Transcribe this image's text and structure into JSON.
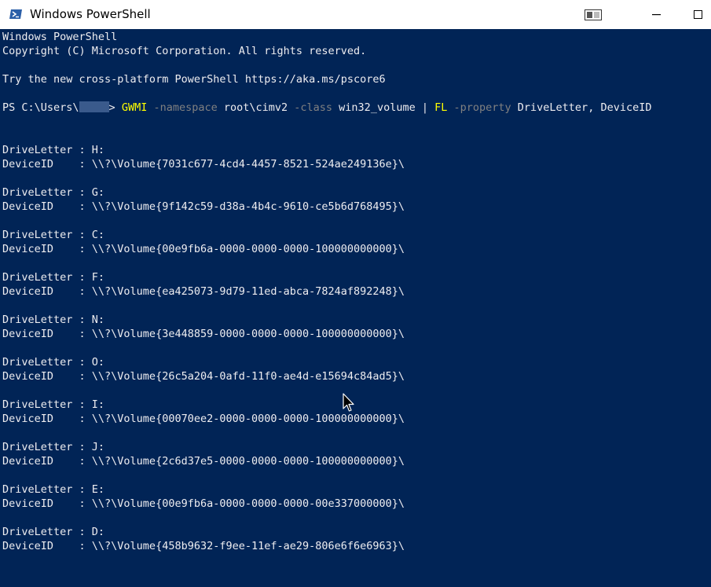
{
  "window": {
    "title": "Windows PowerShell",
    "icon": "powershell-icon",
    "controls": [
      "snap-icon",
      "minimize-icon",
      "maximize-icon"
    ]
  },
  "colors": {
    "console_bg": "#012456",
    "console_text": "#eeedf0",
    "command": "#ffff00",
    "parameter": "#808080"
  },
  "console": {
    "banner": [
      "Windows PowerShell",
      "Copyright (C) Microsoft Corporation. All rights reserved.",
      "",
      "Try the new cross-platform PowerShell https://aka.ms/pscore6"
    ],
    "prompt": {
      "prefix": "PS C:\\Users\\",
      "suffix": "> ",
      "cmd1": "GWMI",
      "p1": " -namespace",
      "a1": " root\\cimv2",
      "p2": " -class",
      "a2": " win32_volume",
      "pipe": " | ",
      "cmd2": "FL",
      "p3": " -property",
      "a3": " DriveLetter, DeviceID"
    },
    "volumes": [
      {
        "drive_line": "DriveLetter : H:",
        "device_line": "DeviceID    : \\\\?\\Volume{7031c677-4cd4-4457-8521-524ae249136e}\\"
      },
      {
        "drive_line": "DriveLetter : G:",
        "device_line": "DeviceID    : \\\\?\\Volume{9f142c59-d38a-4b4c-9610-ce5b6d768495}\\"
      },
      {
        "drive_line": "DriveLetter : C:",
        "device_line": "DeviceID    : \\\\?\\Volume{00e9fb6a-0000-0000-0000-100000000000}\\"
      },
      {
        "drive_line": "DriveLetter : F:",
        "device_line": "DeviceID    : \\\\?\\Volume{ea425073-9d79-11ed-abca-7824af892248}\\"
      },
      {
        "drive_line": "DriveLetter : N:",
        "device_line": "DeviceID    : \\\\?\\Volume{3e448859-0000-0000-0000-100000000000}\\"
      },
      {
        "drive_line": "DriveLetter : O:",
        "device_line": "DeviceID    : \\\\?\\Volume{26c5a204-0afd-11f0-ae4d-e15694c84ad5}\\"
      },
      {
        "drive_line": "DriveLetter : I:",
        "device_line": "DeviceID    : \\\\?\\Volume{00070ee2-0000-0000-0000-100000000000}\\"
      },
      {
        "drive_line": "DriveLetter : J:",
        "device_line": "DeviceID    : \\\\?\\Volume{2c6d37e5-0000-0000-0000-100000000000}\\"
      },
      {
        "drive_line": "DriveLetter : E:",
        "device_line": "DeviceID    : \\\\?\\Volume{00e9fb6a-0000-0000-0000-00e337000000}\\"
      },
      {
        "drive_line": "DriveLetter : D:",
        "device_line": "DeviceID    : \\\\?\\Volume{458b9632-f9ee-11ef-ae29-806e6f6e6963}\\"
      }
    ]
  }
}
